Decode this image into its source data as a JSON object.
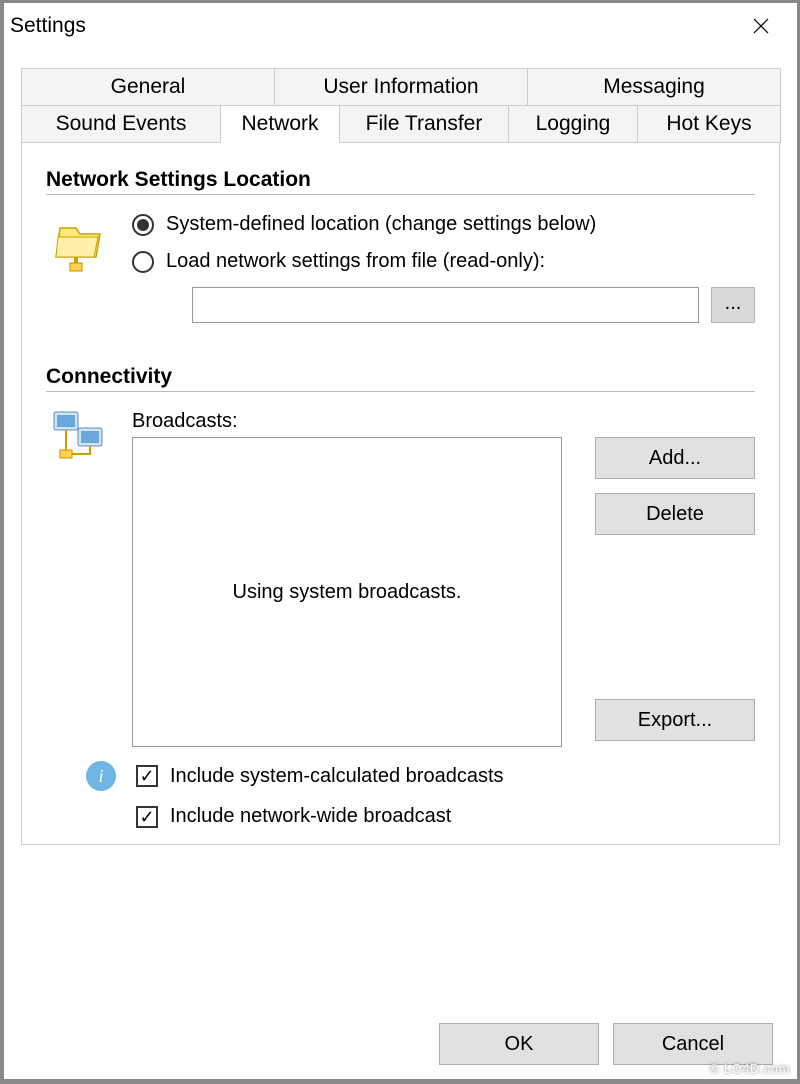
{
  "window": {
    "title": "Settings"
  },
  "tabs": {
    "row1": [
      "General",
      "User Information",
      "Messaging"
    ],
    "row2": [
      "Sound Events",
      "Network",
      "File Transfer",
      "Logging",
      "Hot Keys"
    ],
    "active": "Network"
  },
  "network_location": {
    "header": "Network Settings Location",
    "radio_system": "System-defined location (change settings below)",
    "radio_file": "Load network settings from file (read-only):",
    "file_value": "",
    "browse": "..."
  },
  "connectivity": {
    "header": "Connectivity",
    "broadcasts_label": "Broadcasts:",
    "listbox_text": "Using system broadcasts.",
    "add": "Add...",
    "delete": "Delete",
    "export": "Export...",
    "chk_system": "Include system-calculated broadcasts",
    "chk_networkwide": "Include network-wide broadcast"
  },
  "footer": {
    "ok": "OK",
    "cancel": "Cancel"
  },
  "watermark": "© LO4D.com"
}
